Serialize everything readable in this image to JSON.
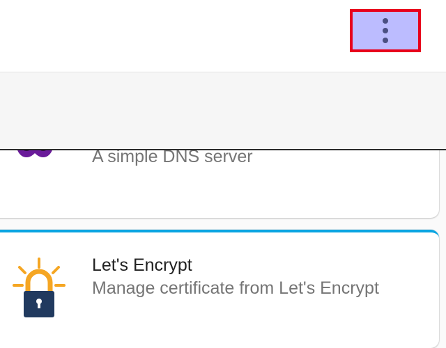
{
  "header": {
    "menu_icon": "more-vert-icon",
    "highlight_color": "#e8001c"
  },
  "addons": [
    {
      "icon": "mask-icon",
      "description": "A simple DNS server"
    },
    {
      "icon": "lets-encrypt-lock-icon",
      "title": "Let's Encrypt",
      "description": "Manage certificate from Let's Encrypt",
      "accent_color": "#0aa5e2"
    }
  ]
}
